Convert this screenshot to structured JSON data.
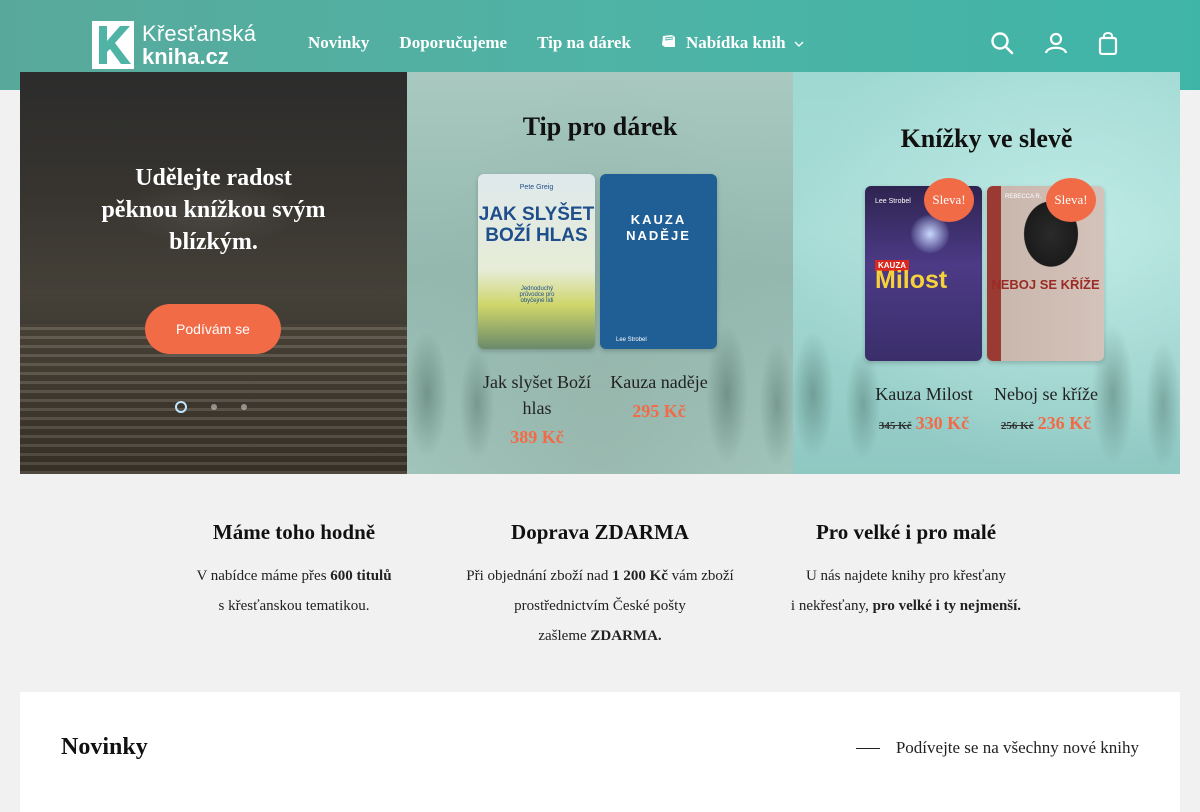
{
  "header": {
    "logo_line1": "Křesťanská",
    "logo_line2": "kniha.cz",
    "nav": [
      {
        "label": "Novinky"
      },
      {
        "label": "Doporučujeme"
      },
      {
        "label": "Tip na dárek"
      },
      {
        "label": "Nabídka knih"
      }
    ],
    "icons": [
      "search-icon",
      "account-icon",
      "cart-icon"
    ]
  },
  "hero": {
    "slide": {
      "headline": "Udělejte radost pěknou knížkou svým blízkým.",
      "button": "Podívám se",
      "dots": 3,
      "active_dot": 1
    },
    "gift": {
      "title": "Tip pro dárek",
      "products": [
        {
          "name": "Jak slyšet Boží hlas",
          "price": "389 Kč",
          "cover_author": "Pete Greig",
          "cover_title": "JAK SLYŠET BOŽÍ HLAS",
          "cover_sub": "Jednoduchý průvodce pro obyčejné lidi"
        },
        {
          "name": "Kauza naděje",
          "price": "295 Kč",
          "cover_title": "KAUZA NADĚJE",
          "cover_author": "Lee Strobel"
        }
      ]
    },
    "sale": {
      "title": "Knížky ve slevě",
      "badge": "Sleva!",
      "products": [
        {
          "name": "Kauza Milost",
          "old_price": "345 Kč",
          "price": "330 Kč",
          "cover_author": "Lee Strobel",
          "cover_kauza": "KAUZA",
          "cover_title": "Milost"
        },
        {
          "name": "Neboj se kříže",
          "old_price": "256 Kč",
          "price": "236 Kč",
          "cover_author": "REBECCA R.",
          "cover_title": "NEBOJ SE KŘÍŽE"
        }
      ]
    }
  },
  "features": [
    {
      "title": "Máme toho hodně",
      "text_a": "V nabídce máme přes ",
      "bold_a": "600 titulů",
      "text_b": "s křesťanskou tematikou."
    },
    {
      "title": "Doprava ZDARMA",
      "text_a": "Při objednání zboží nad ",
      "bold_a": "1 200 Kč",
      "text_b": " vám zboží prostřednictvím České pošty",
      "text_c": "zašleme ",
      "bold_c": "ZDARMA."
    },
    {
      "title": "Pro velké i pro malé",
      "text_a": "U nás najdete knihy pro křesťany",
      "text_b": "i nekřesťany, ",
      "bold_b": "pro velké i ty nejmenší."
    }
  ],
  "novinky": {
    "title": "Novinky",
    "link": "Podívejte se na všechny nové knihy"
  },
  "colors": {
    "header_teal": "#4fb3a5",
    "accent_orange": "#f26b47",
    "background": "#f1f1f1"
  }
}
